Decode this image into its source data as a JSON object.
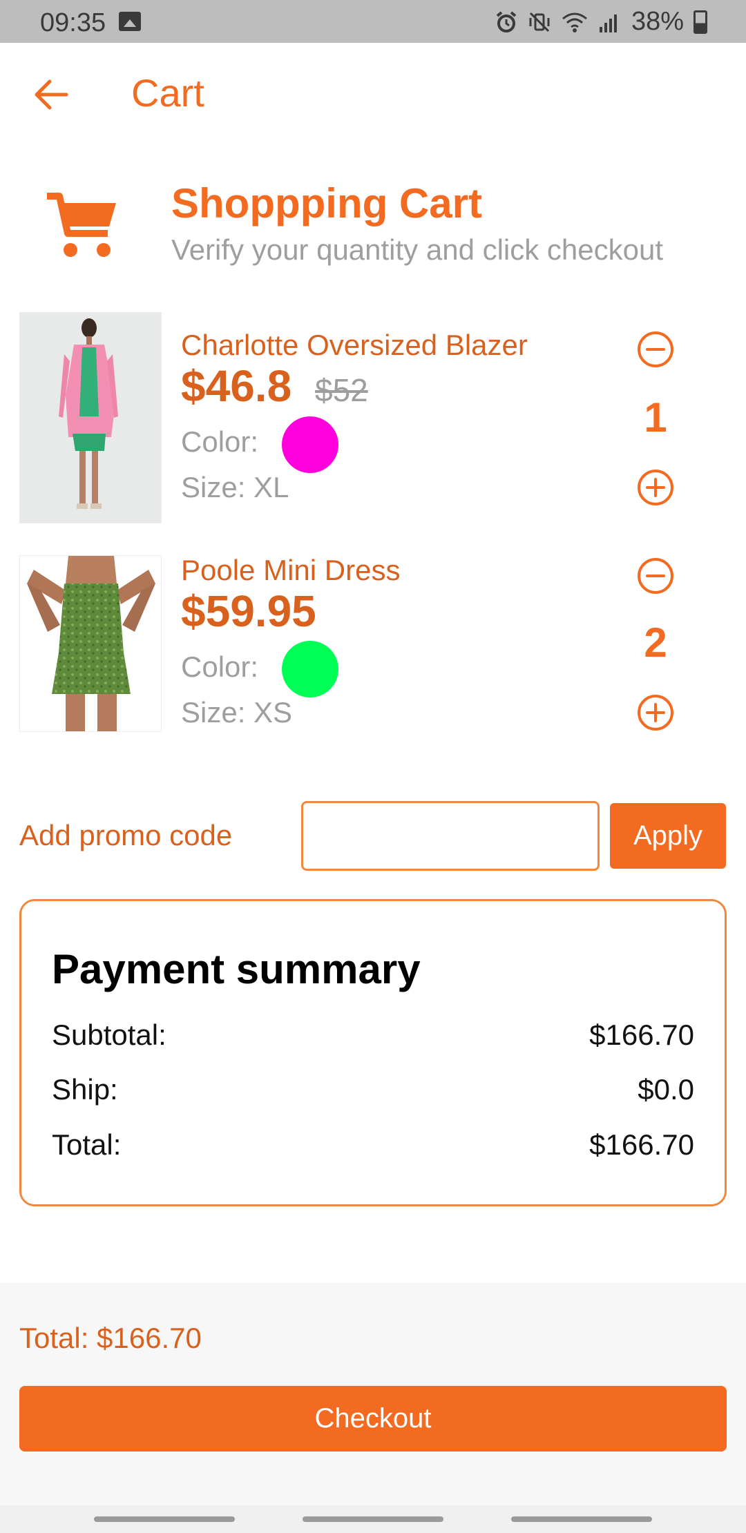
{
  "status_bar": {
    "time": "09:35",
    "battery": "38%"
  },
  "app_bar": {
    "title": "Cart"
  },
  "cart_header": {
    "title": "Shoppping Cart",
    "subtitle": "Verify your quantity and click checkout"
  },
  "items": [
    {
      "name": "Charlotte Oversized Blazer",
      "price": "$46.8",
      "old_price": "$52",
      "color_label": "Color:",
      "color": "#ff00dd",
      "size": "Size: XL",
      "quantity": "1"
    },
    {
      "name": "Poole Mini Dress",
      "price": "$59.95",
      "color_label": "Color:",
      "color": "#00ff55",
      "size": "Size: XS",
      "quantity": "2"
    }
  ],
  "promo": {
    "label": "Add promo code",
    "value": "",
    "apply_label": "Apply"
  },
  "summary": {
    "title": "Payment summary",
    "rows": [
      {
        "label": "Subtotal:",
        "value": "$166.70"
      },
      {
        "label": "Ship:",
        "value": "$0.0"
      },
      {
        "label": "Total:",
        "value": "$166.70"
      }
    ]
  },
  "footer": {
    "total": "Total: $166.70",
    "checkout_label": "Checkout"
  },
  "colors": {
    "accent": "#f26b21",
    "accent_dark": "#d9611e",
    "muted": "#9e9e9e"
  }
}
